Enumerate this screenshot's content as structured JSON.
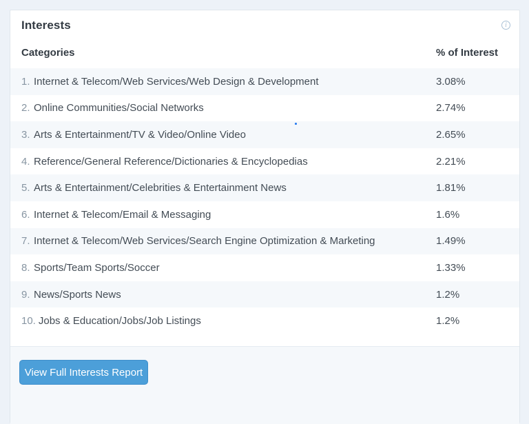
{
  "panel": {
    "title": "Interests",
    "info_icon_glyph": "i"
  },
  "table": {
    "headers": {
      "categories": "Categories",
      "percent": "% of Interest"
    },
    "rows": [
      {
        "rank": "1.",
        "category": "Internet & Telecom/Web Services/Web Design & Development",
        "percent": "3.08%"
      },
      {
        "rank": "2.",
        "category": "Online Communities/Social Networks",
        "percent": "2.74%"
      },
      {
        "rank": "3.",
        "category": "Arts & Entertainment/TV & Video/Online Video",
        "percent": "2.65%"
      },
      {
        "rank": "4.",
        "category": "Reference/General Reference/Dictionaries & Encyclopedias",
        "percent": "2.21%"
      },
      {
        "rank": "5.",
        "category": "Arts & Entertainment/Celebrities & Entertainment News",
        "percent": "1.81%"
      },
      {
        "rank": "6.",
        "category": "Internet & Telecom/Email & Messaging",
        "percent": "1.6%"
      },
      {
        "rank": "7.",
        "category": "Internet & Telecom/Web Services/Search Engine Optimization & Marketing",
        "percent": "1.49%"
      },
      {
        "rank": "8.",
        "category": "Sports/Team Sports/Soccer",
        "percent": "1.33%"
      },
      {
        "rank": "9.",
        "category": "News/Sports News",
        "percent": "1.2%"
      },
      {
        "rank": "10.",
        "category": "Jobs & Education/Jobs/Job Listings",
        "percent": "1.2%"
      }
    ]
  },
  "footer": {
    "button_label": "View Full Interests Report"
  },
  "colors": {
    "page_bg": "#edf2f8",
    "card_bg": "#ffffff",
    "card_border": "#dfe6ec",
    "row_alt_bg": "#f5f8fb",
    "footer_bg": "#f5f8fb",
    "button_bg": "#4c9fd9",
    "button_border": "#3e8ecb",
    "button_text": "#ffffff",
    "heading_text": "#333b43",
    "body_text": "#434c55",
    "rank_text": "#8795a2",
    "info_icon": "#a9c0d6"
  }
}
